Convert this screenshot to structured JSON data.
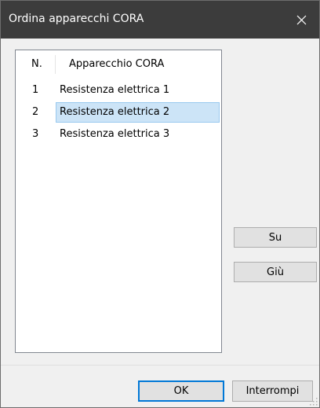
{
  "window": {
    "title": "Ordina apparecchi CORA"
  },
  "icons": {
    "close": "close-icon",
    "grip": "size-grip-icon"
  },
  "list": {
    "columns": [
      "N.",
      "Apparecchio CORA"
    ],
    "rows": [
      {
        "num": "1",
        "name": "Resistenza elettrica 1",
        "selected": false
      },
      {
        "num": "2",
        "name": "Resistenza elettrica 2",
        "selected": true
      },
      {
        "num": "3",
        "name": "Resistenza elettrica 3",
        "selected": false
      }
    ]
  },
  "buttons": {
    "up": "Su",
    "down": "Giù",
    "ok": "OK",
    "cancel": "Interrompi"
  },
  "colors": {
    "titlebar": "#3c3c3c",
    "selection": "#cce4f7",
    "focus_border": "#0078d7"
  }
}
